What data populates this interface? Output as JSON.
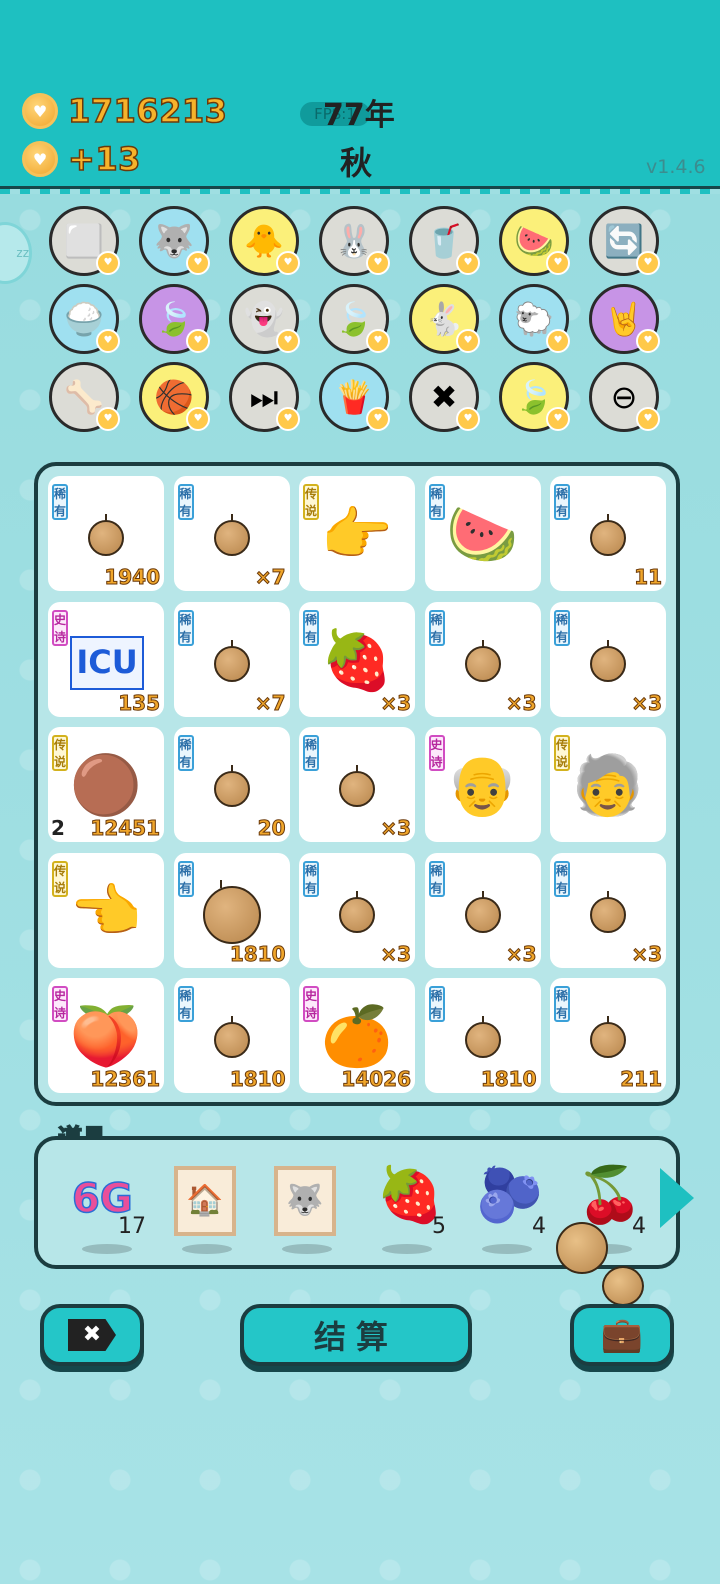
{
  "header": {
    "coins": "1716213",
    "income": "+13",
    "year": "77年",
    "fps": "FPS:1",
    "season": "秋",
    "version": "v1.4.6",
    "side_tab": "zz"
  },
  "skills": [
    {
      "icon": "sugar-cubes",
      "glyph": "⬜",
      "bg": "#dcdcd6"
    },
    {
      "icon": "husky-dog",
      "glyph": "🐺",
      "bg": "#9fe0f0"
    },
    {
      "icon": "chick-egg",
      "glyph": "🐥",
      "bg": "#fbf07a"
    },
    {
      "icon": "rabbit",
      "glyph": "🐰",
      "bg": "#dcdcd6"
    },
    {
      "icon": "milk-tea",
      "glyph": "🥤",
      "bg": "#dcdcd6"
    },
    {
      "icon": "fruit-bowl",
      "glyph": "🍉",
      "bg": "#fbf07a"
    },
    {
      "icon": "refresh",
      "glyph": "🔄",
      "bg": "#dcdcd6"
    },
    {
      "icon": "rice-bowl",
      "glyph": "🍚",
      "bg": "#9fe0f0"
    },
    {
      "icon": "leaf-purple",
      "glyph": "🍃",
      "bg": "#c794e6"
    },
    {
      "icon": "ghost",
      "glyph": "👻",
      "bg": "#dcdcd6"
    },
    {
      "icon": "leaf-gray",
      "glyph": "🍃",
      "bg": "#dcdcd6"
    },
    {
      "icon": "rabbit-yellow",
      "glyph": "🐇",
      "bg": "#fbf07a"
    },
    {
      "icon": "two-sheep",
      "glyph": "🐑",
      "bg": "#9fe0f0"
    },
    {
      "icon": "rock-hand",
      "glyph": "🤘",
      "bg": "#c794e6"
    },
    {
      "icon": "dog-bowl",
      "glyph": "🦴",
      "bg": "#dcdcd6"
    },
    {
      "icon": "basketballs",
      "glyph": "🏀",
      "bg": "#fbf07a"
    },
    {
      "icon": "skip-next",
      "glyph": "⏭",
      "bg": "#dcdcd6"
    },
    {
      "icon": "french-fries",
      "glyph": "🍟",
      "bg": "#9fe0f0"
    },
    {
      "icon": "delete-tag",
      "glyph": "✖",
      "bg": "#dcdcd6"
    },
    {
      "icon": "leaf-yellow",
      "glyph": "🍃",
      "bg": "#fbf07a"
    },
    {
      "icon": "minus-circle",
      "glyph": "⊖",
      "bg": "#dcdcd6"
    }
  ],
  "grid": [
    [
      {
        "tag": "稀有",
        "tagType": "rare",
        "item": "nut",
        "count": "1940"
      },
      {
        "tag": "稀有",
        "tagType": "rare",
        "item": "nut",
        "count": "×7"
      },
      {
        "tag": "传说",
        "tagType": "legend",
        "item": "pointing-hand",
        "glyph": "👉",
        "count": ""
      },
      {
        "tag": "稀有",
        "tagType": "rare",
        "item": "watermelon",
        "glyph": "🍉",
        "count": ""
      },
      {
        "tag": "稀有",
        "tagType": "rare",
        "item": "nut",
        "count": "11"
      }
    ],
    [
      {
        "tag": "史诗",
        "tagType": "epic",
        "item": "icu",
        "text": "ICU",
        "count": "135"
      },
      {
        "tag": "稀有",
        "tagType": "rare",
        "item": "nut",
        "count": "×7"
      },
      {
        "tag": "稀有",
        "tagType": "rare",
        "item": "lychee",
        "glyph": "🍓",
        "count": "×3"
      },
      {
        "tag": "稀有",
        "tagType": "rare",
        "item": "nut",
        "count": "×3"
      },
      {
        "tag": "稀有",
        "tagType": "rare",
        "item": "nut",
        "count": "×3"
      }
    ],
    [
      {
        "tag": "传说",
        "tagType": "legend",
        "item": "longan-bunch",
        "glyph": "🟤",
        "count": "12451",
        "level": "2"
      },
      {
        "tag": "稀有",
        "tagType": "rare",
        "item": "nut",
        "count": "20"
      },
      {
        "tag": "稀有",
        "tagType": "rare",
        "item": "nut",
        "count": "×3"
      },
      {
        "tag": "史诗",
        "tagType": "epic",
        "item": "farmer-man",
        "glyph": "👴",
        "count": ""
      },
      {
        "tag": "传说",
        "tagType": "legend",
        "item": "bald-man-glasses",
        "glyph": "🧓",
        "count": ""
      }
    ],
    [
      {
        "tag": "传说",
        "tagType": "legend",
        "item": "pointing-hand-left",
        "glyph": "👈",
        "count": ""
      },
      {
        "tag": "稀有",
        "tagType": "rare",
        "item": "big-nut",
        "count": "1810"
      },
      {
        "tag": "稀有",
        "tagType": "rare",
        "item": "nut",
        "count": "×3"
      },
      {
        "tag": "稀有",
        "tagType": "rare",
        "item": "nut",
        "count": "×3"
      },
      {
        "tag": "稀有",
        "tagType": "rare",
        "item": "nut",
        "count": "×3"
      }
    ],
    [
      {
        "tag": "史诗",
        "tagType": "epic",
        "item": "peach",
        "glyph": "🍑",
        "count": "12361"
      },
      {
        "tag": "稀有",
        "tagType": "rare",
        "item": "nut",
        "count": "1810"
      },
      {
        "tag": "史诗",
        "tagType": "epic",
        "item": "orange",
        "glyph": "🍊",
        "count": "14026"
      },
      {
        "tag": "稀有",
        "tagType": "rare",
        "item": "nut",
        "count": "1810"
      },
      {
        "tag": "稀有",
        "tagType": "rare",
        "item": "nut",
        "count": "211"
      }
    ]
  ],
  "props": {
    "label": "道具",
    "items": [
      {
        "icon": "6g-badge",
        "text": "6G",
        "count": "17"
      },
      {
        "icon": "windmill-frame",
        "glyph": "🏠",
        "count": ""
      },
      {
        "icon": "husky-frame",
        "glyph": "🐺",
        "count": ""
      },
      {
        "icon": "strawberry",
        "glyph": "🍓",
        "count": "5"
      },
      {
        "icon": "blueberry",
        "glyph": "🫐",
        "count": "4"
      },
      {
        "icon": "lychee",
        "glyph": "🍒",
        "count": "4"
      }
    ]
  },
  "bottom": {
    "settle_label": "结算",
    "delete_icon": "✖",
    "bag_icon": "💼"
  }
}
